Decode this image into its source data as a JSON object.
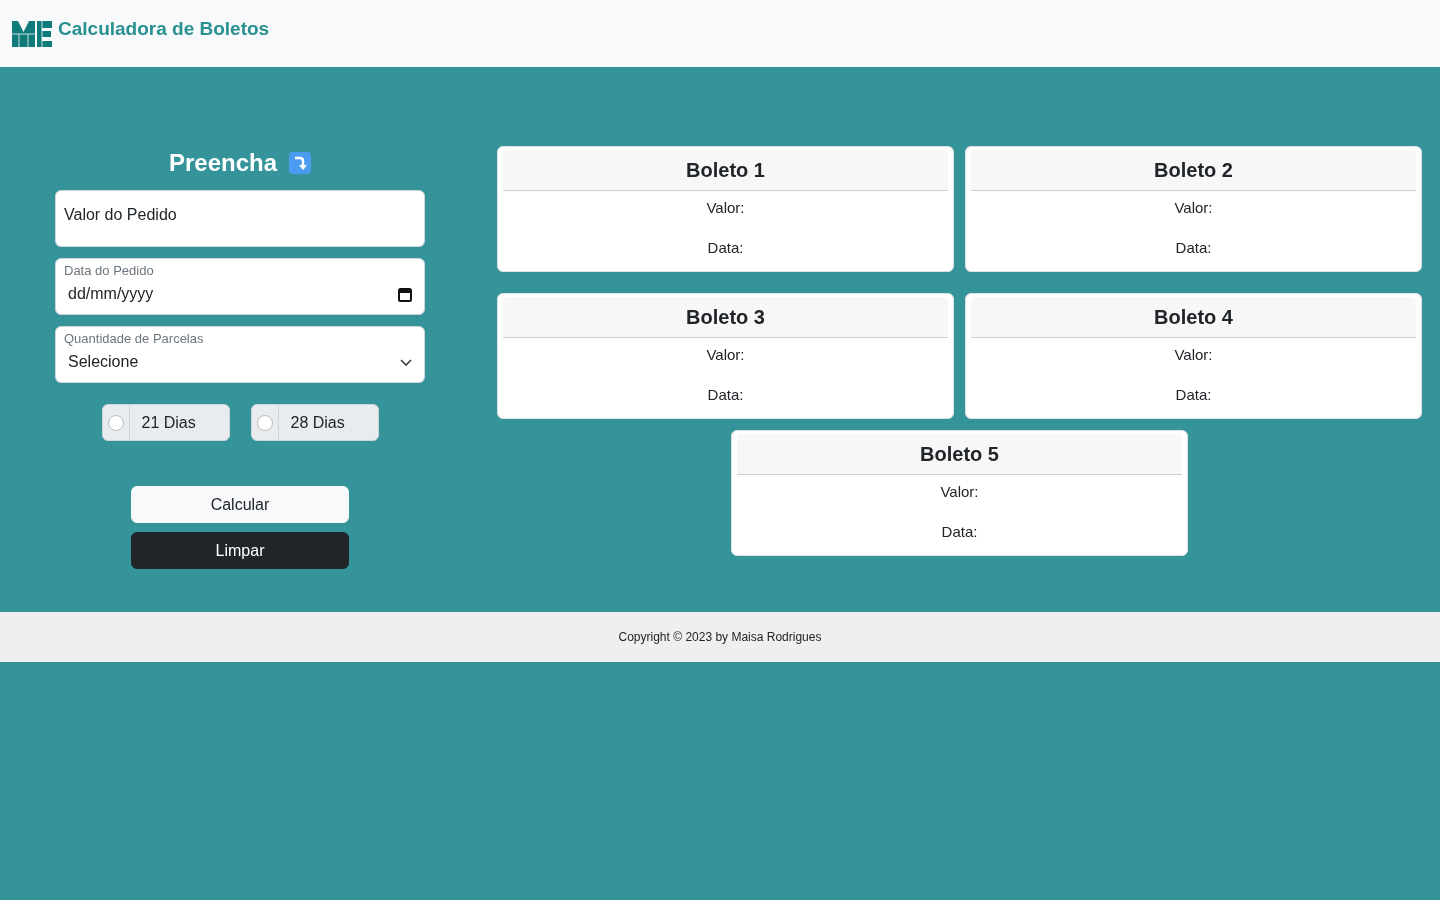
{
  "header": {
    "title": "Calculadora de Boletos"
  },
  "form": {
    "heading": "Preencha",
    "fields": [
      {
        "kind": "text",
        "placeholder": "Valor do Pedido"
      },
      {
        "kind": "date",
        "label": "Data do Pedido",
        "placeholder": "dd/mm/yyyy"
      },
      {
        "kind": "select",
        "label": "Quantidade de Parcelas",
        "value": "Selecione"
      }
    ],
    "intervals": [
      {
        "label": "21 Dias",
        "selected": false
      },
      {
        "label": "28 Dias",
        "selected": false
      }
    ],
    "buttons": [
      {
        "label": "Calcular",
        "kind": "light"
      },
      {
        "label": "Limpar",
        "kind": "dark"
      }
    ]
  },
  "boletos": [
    {
      "title": "Boleto 1",
      "value_label": "Valor:",
      "date_label": "Data:"
    },
    {
      "title": "Boleto 2",
      "value_label": "Valor:",
      "date_label": "Data:"
    },
    {
      "title": "Boleto 3",
      "value_label": "Valor:",
      "date_label": "Data:"
    },
    {
      "title": "Boleto 4",
      "value_label": "Valor:",
      "date_label": "Data:"
    },
    {
      "title": "Boleto 5",
      "value_label": "Valor:",
      "date_label": "Data:"
    }
  ],
  "footer": {
    "text": "Copyright © 2023 by Maisa Rodrigues"
  }
}
